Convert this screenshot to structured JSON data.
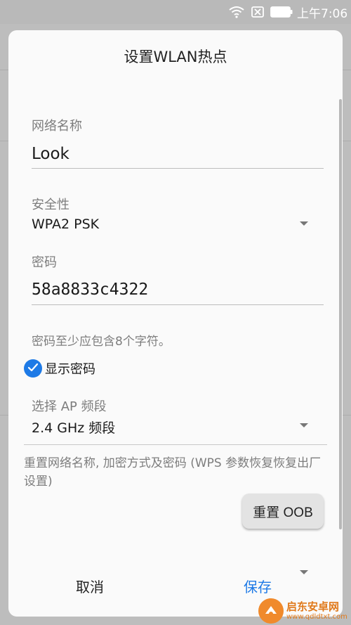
{
  "status_bar": {
    "time": "上午7:06",
    "icons": [
      "wifi-icon",
      "no-sim-icon",
      "battery-icon"
    ],
    "text_color": "#ffffff"
  },
  "dialog": {
    "title": "设置WLAN热点",
    "network_name": {
      "label": "网络名称",
      "value": "Look"
    },
    "security": {
      "label": "安全性",
      "value": "WPA2 PSK"
    },
    "password": {
      "label": "密码",
      "value": "58a8833c4322",
      "hint": "密码至少应包含8个字符。"
    },
    "show_password": {
      "label": "显示密码",
      "checked": true
    },
    "ap_band": {
      "label": "选择 AP 频段",
      "value": "2.4 GHz 频段"
    },
    "reset": {
      "description": "重置网络名称, 加密方式及密码 (WPS 参数恢复恢复出厂设置)",
      "button_label": "重置 OOB"
    },
    "cancel_label": "取消",
    "save_label": "保存",
    "accent_color": "#1e7ae6"
  },
  "watermark": {
    "name": "启东安卓网",
    "url": "www.qdldtxt.com"
  }
}
